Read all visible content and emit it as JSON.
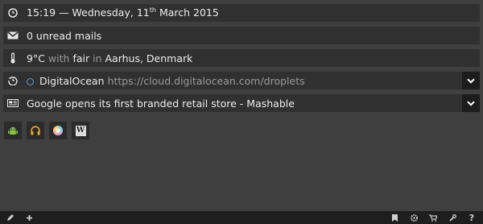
{
  "clock": {
    "time": "15:19",
    "sep": "—",
    "weekday": "Wednesday,",
    "day": "11",
    "suffix": "th",
    "month_year": "March 2015"
  },
  "mail": {
    "text": "0 unread mails"
  },
  "weather": {
    "temp": "9°C",
    "with": "with",
    "condition": "fair",
    "in": "in",
    "location": "Aarhus, Denmark"
  },
  "history": {
    "title": "DigitalOcean",
    "url": "https://cloud.digitalocean.com/droplets"
  },
  "news": {
    "headline": "Google opens its first branded retail store - Mashable"
  },
  "apps": [
    "android-app",
    "headphones-app",
    "color-wheel-app",
    "wikipedia-app"
  ],
  "wikipedia_glyph": "W",
  "bottom_bar": {
    "left": [
      "edit-icon",
      "add-icon"
    ],
    "right": [
      "bookmark-icon",
      "settings-icon",
      "cart-icon",
      "wrench-icon",
      "help-icon"
    ],
    "help_glyph": "?"
  },
  "colors": {
    "background": "#3f3f3f",
    "row": "#303030",
    "bar": "#1e1e1e",
    "text": "#ececec",
    "dim": "#9a9a9a"
  }
}
